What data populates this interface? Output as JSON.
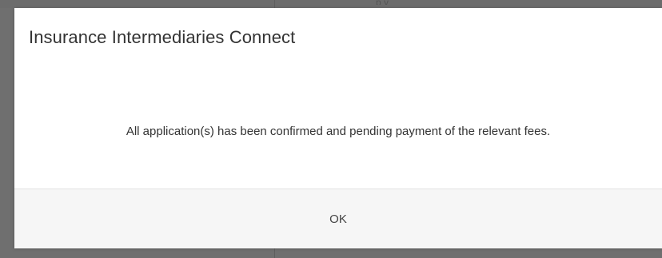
{
  "dialog": {
    "title": "Insurance Intermediaries Connect",
    "message": "All application(s) has been confirmed and pending payment of the relevant fees.",
    "ok_label": "OK"
  },
  "background": {
    "fragment_text": "p          y"
  }
}
